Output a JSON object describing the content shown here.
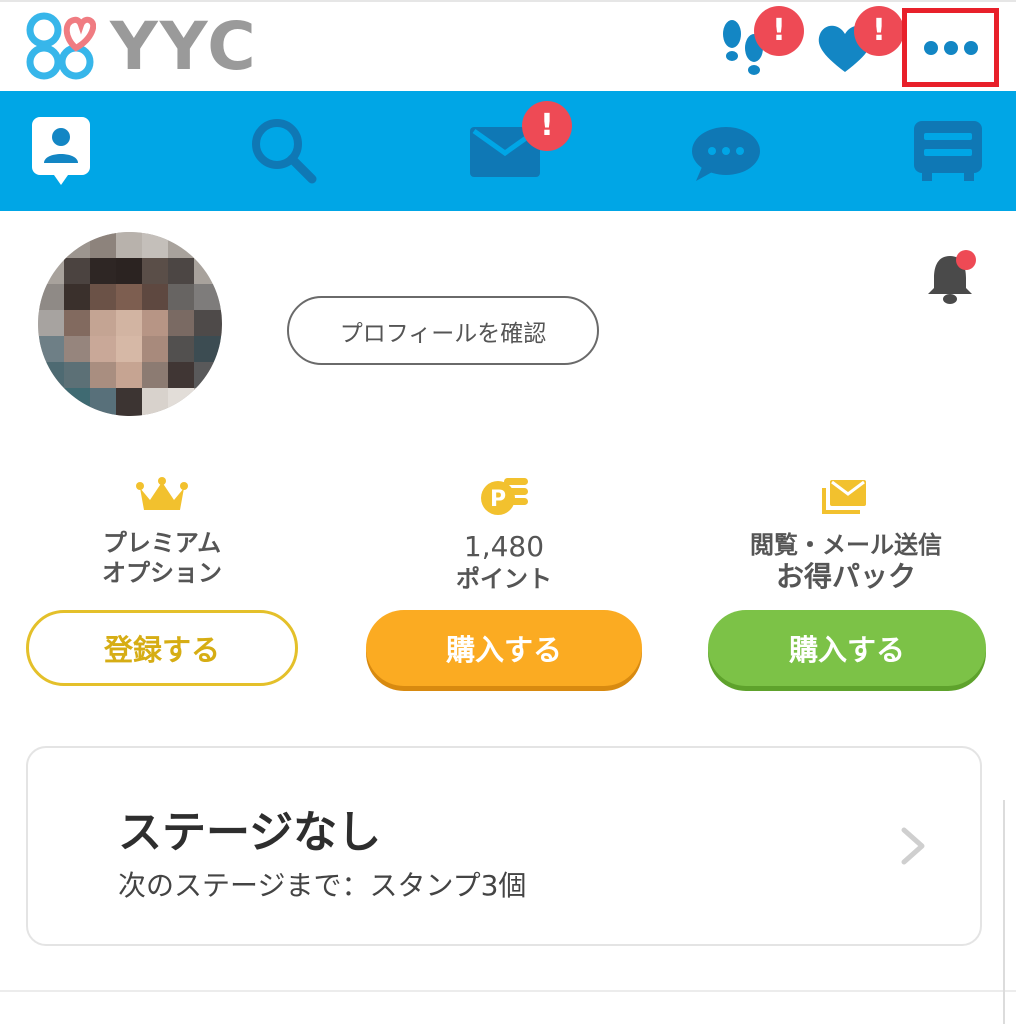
{
  "header": {
    "logo_text": "YYC",
    "icons": [
      "footprints-icon",
      "heart-icon",
      "more-icon"
    ],
    "footprints_badge": "!",
    "likes_badge": "!"
  },
  "nav": {
    "items": [
      "profile-icon",
      "search-icon",
      "mail-icon",
      "chat-icon",
      "board-icon"
    ],
    "mail_badge": "!"
  },
  "profile": {
    "check_button": "プロフィールを確認"
  },
  "columns": {
    "premium": {
      "label_line1": "プレミアム",
      "label_line2": "オプション",
      "button": "登録する"
    },
    "points": {
      "value": "1,480",
      "label": "ポイント",
      "button": "購入する"
    },
    "pack": {
      "label_line1": "閲覧・メール送信",
      "label_line2": "お得パック",
      "button": "購入する"
    }
  },
  "stage": {
    "title": "ステージなし",
    "subtitle": "次のステージまで：スタンプ3個"
  },
  "colors": {
    "nav_blue": "#00a6e6",
    "badge_red": "#ee4a55",
    "icon_blue": "#1386c4",
    "gold": "#e4c02a",
    "orange": "#fbab22",
    "green": "#7cc247"
  }
}
